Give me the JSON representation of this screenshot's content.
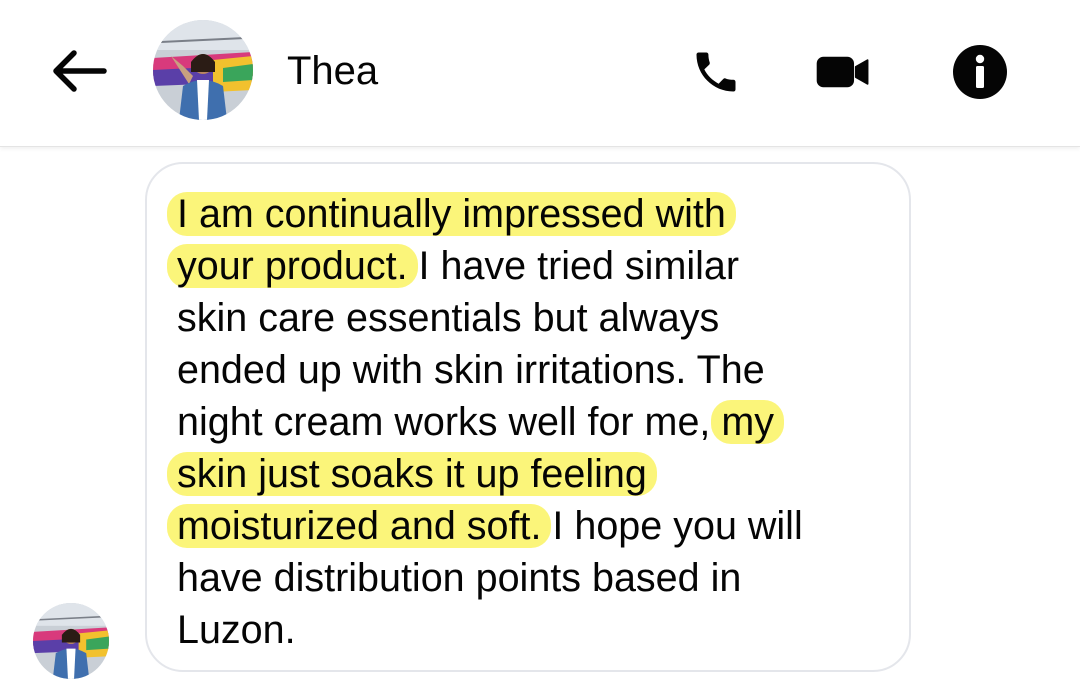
{
  "header": {
    "contact_name": "Thea",
    "icons": [
      "back-arrow-icon",
      "phone-icon",
      "video-camera-icon",
      "info-icon"
    ]
  },
  "message": {
    "lines": [
      {
        "segments": [
          {
            "text": "I am continually impressed with",
            "highlight": true
          }
        ]
      },
      {
        "segments": [
          {
            "text": "your product.",
            "highlight": true
          },
          {
            "text": " I have tried similar",
            "highlight": false
          }
        ]
      },
      {
        "segments": [
          {
            "text": "skin care essentials but always",
            "highlight": false
          }
        ]
      },
      {
        "segments": [
          {
            "text": "ended up with skin irritations. The",
            "highlight": false
          }
        ]
      },
      {
        "segments": [
          {
            "text": "night cream works well for me, ",
            "highlight": false
          },
          {
            "text": "my",
            "highlight": true
          }
        ]
      },
      {
        "segments": [
          {
            "text": "skin just soaks it up feeling",
            "highlight": true
          }
        ]
      },
      {
        "segments": [
          {
            "text": "moisturized and soft.",
            "highlight": true
          },
          {
            "text": " I hope you will",
            "highlight": false
          }
        ]
      },
      {
        "segments": [
          {
            "text": "have distribution points based in",
            "highlight": false
          }
        ]
      },
      {
        "segments": [
          {
            "text": "Luzon.",
            "highlight": false
          }
        ]
      }
    ],
    "highlight_color": "#fbf57a",
    "bubble_border_color": "#e4e6eb"
  }
}
